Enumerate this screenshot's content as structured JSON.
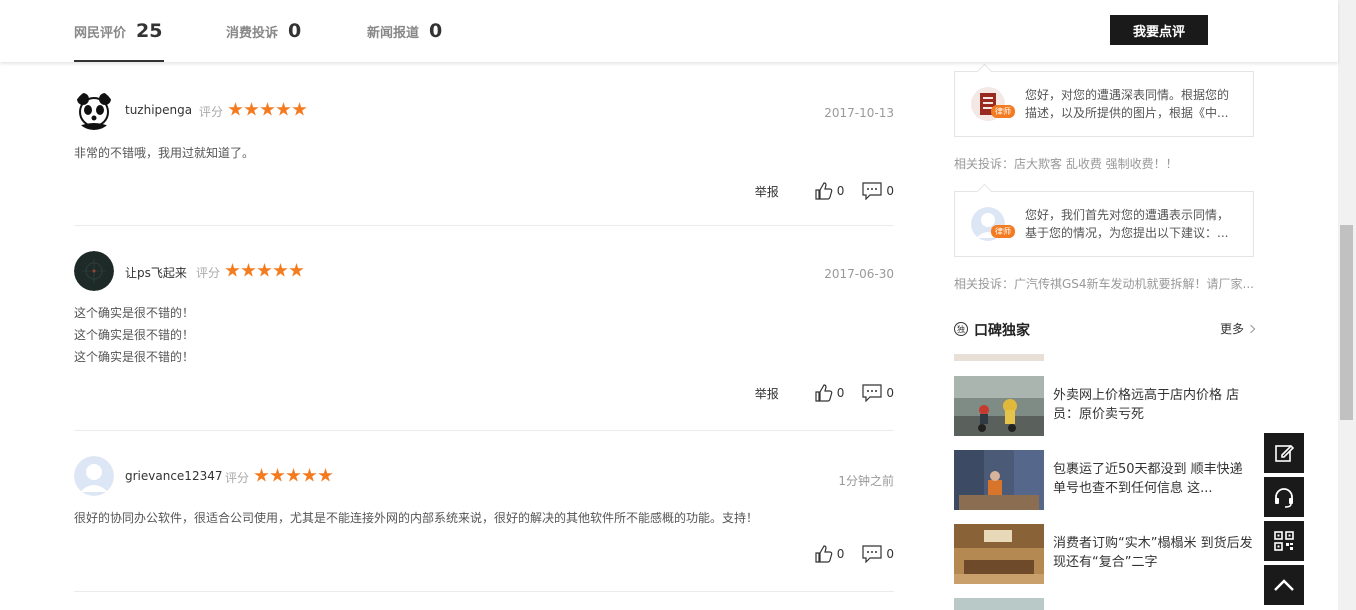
{
  "tabs": [
    {
      "label": "网民评价",
      "count": "25"
    },
    {
      "label": "消费投诉",
      "count": "0"
    },
    {
      "label": "新闻报道",
      "count": "0"
    }
  ],
  "write_review_label": "我要点评",
  "reviews": [
    {
      "username": "tuzhipenga",
      "rating_label": "评分",
      "stars": 5,
      "date": "2017-10-13",
      "lines": [
        "非常的不错哦，我用过就知道了。"
      ],
      "report_label": "举报",
      "likes": "0",
      "comments": "0"
    },
    {
      "username": "让ps飞起来",
      "rating_label": "评分",
      "stars": 5,
      "date": "2017-06-30",
      "lines": [
        "这个确实是很不错的！",
        "这个确实是很不错的！",
        "这个确实是很不错的！"
      ],
      "report_label": "举报",
      "likes": "0",
      "comments": "0"
    },
    {
      "username": "grievance12347",
      "rating_label": "评分",
      "stars": 5,
      "date": "1分钟之前",
      "lines": [
        "很好的协同办公软件，很适合公司使用，尤其是不能连接外网的内部系统来说，很好的解决的其他软件所不能感概的功能。支持！"
      ],
      "likes": "0",
      "comments": "0"
    }
  ],
  "sidebar": {
    "qa": [
      {
        "badge": "律师",
        "text": "您好，对您的遭遇深表同情。根据您的描述，以及所提供的图片，根据《中...",
        "related": "相关投诉：店大欺客 乱收费 强制收费！！"
      },
      {
        "badge": "律师",
        "text": "您好，我们首先对您的遭遇表示同情，基于您的情况，为您提出以下建议：...",
        "related": "相关投诉：广汽传祺GS4新车发动机就要拆解！请厂家..."
      }
    ],
    "section_icon": "独",
    "section_title": "口碑独家",
    "more_label": "更多",
    "news": [
      {
        "title": "外卖网上价格远高于店内价格 店员：原价卖亏死"
      },
      {
        "title": "包裹运了近50天都没到 顺丰快递单号也查不到任何信息 这..."
      },
      {
        "title": "消费者订购“实木”榻榻米 到货后发现还有“复合”二字"
      }
    ]
  },
  "colors": {
    "accent": "#f47b20",
    "dark": "#1a1a1a"
  }
}
